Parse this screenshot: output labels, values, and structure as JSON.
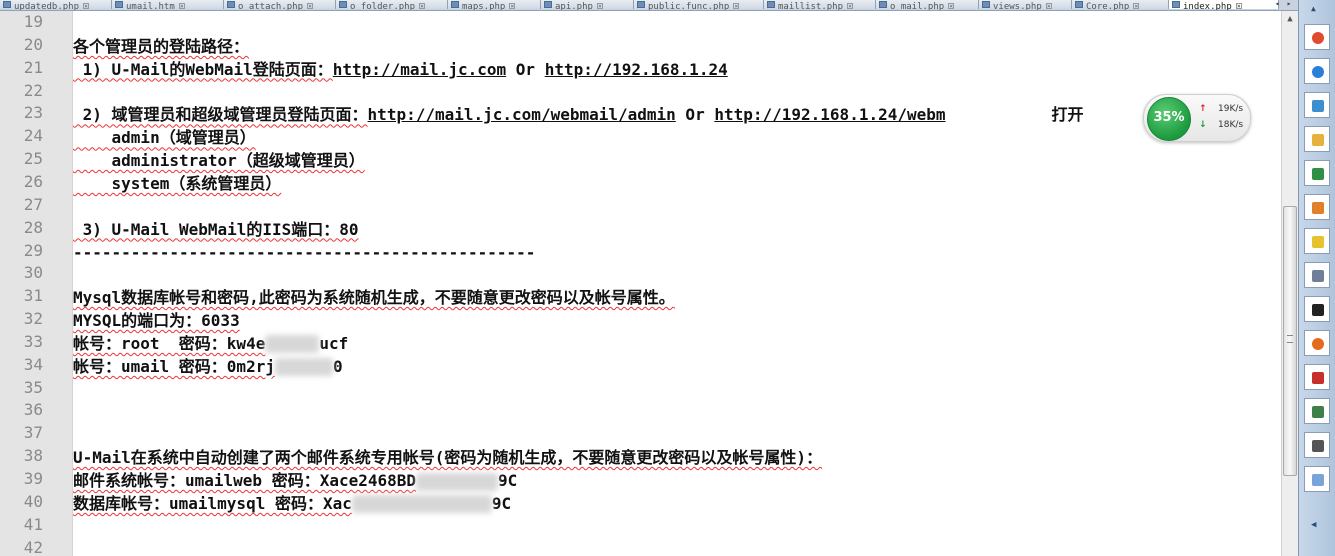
{
  "tabs": [
    {
      "label": "updatedb.php"
    },
    {
      "label": "umail.htm"
    },
    {
      "label": "o_attach.php"
    },
    {
      "label": "o_folder.php"
    },
    {
      "label": "maps.php"
    },
    {
      "label": "api.php"
    },
    {
      "label": "public.func.php"
    },
    {
      "label": "maillist.php"
    },
    {
      "label": "o_mail.php"
    },
    {
      "label": "views.php"
    },
    {
      "label": "Core.php"
    },
    {
      "label": "index.php",
      "active": true
    }
  ],
  "lines": [
    {
      "num": "19",
      "text": ""
    },
    {
      "num": "20",
      "text": "各个管理员的登陆路径："
    },
    {
      "num": "21",
      "pre": " 1) U-Mail的WebMail登陆页面：",
      "url1": "http://mail.jc.com",
      "mid": " Or ",
      "url2": "http://192.168.1.24"
    },
    {
      "num": "22",
      "text": ""
    },
    {
      "num": "23",
      "pre": " 2) 域管理员和超级域管理员登陆页面：",
      "url1": "http://mail.jc.com/webmail/admin",
      "mid": " Or ",
      "url2": "http://192.168.1.24/webm",
      "post": "           打开"
    },
    {
      "num": "24",
      "text": "    admin（域管理员）"
    },
    {
      "num": "25",
      "text": "    administrator（超级域管理员）"
    },
    {
      "num": "26",
      "text": "    system（系统管理员）"
    },
    {
      "num": "27",
      "text": ""
    },
    {
      "num": "28",
      "text": " 3) U-Mail WebMail的IIS端口：80"
    },
    {
      "num": "29",
      "text": "------------------------------------------------"
    },
    {
      "num": "30",
      "text": ""
    },
    {
      "num": "31",
      "text": "Mysql数据库帐号和密码,此密码为系统随机生成，不要随意更改密码以及帐号属性。"
    },
    {
      "num": "32",
      "text": "MYSQL的端口为：6033"
    },
    {
      "num": "33",
      "pre": "帐号：root  密码：kw4e",
      "post": "ucf"
    },
    {
      "num": "34",
      "pre": "帐号：umail 密码：0m2rj",
      "post": "0"
    },
    {
      "num": "35",
      "text": ""
    },
    {
      "num": "36",
      "text": ""
    },
    {
      "num": "37",
      "text": ""
    },
    {
      "num": "38",
      "text": "U-Mail在系统中自动创建了两个邮件系统专用帐号(密码为随机生成，不要随意更改密码以及帐号属性)："
    },
    {
      "num": "39",
      "pre": "邮件系统帐号：umailweb 密码：Xace2468BD",
      "post": "9C"
    },
    {
      "num": "40",
      "pre": "数据库帐号：umailmysql 密码：Xac",
      "post": "9C"
    },
    {
      "num": "41",
      "text": ""
    },
    {
      "num": "42",
      "text": ""
    }
  ],
  "netwidget": {
    "percent": "35%",
    "up_rate": "19K/s",
    "down_rate": "18K/s",
    "up_arrow": "↑",
    "down_arrow": "↓"
  },
  "scrollbar": {
    "up": "▲",
    "down": "▼"
  },
  "launcher": {
    "up_arrow": "▲",
    "down_arrow": "◀",
    "icons": [
      "chrome-icon",
      "ie-icon",
      "app-icon",
      "folder-icon",
      "excel-icon",
      "box-icon",
      "star-icon",
      "doc-icon",
      "cmd-icon",
      "firefox-icon",
      "tool-icon",
      "app2-icon",
      "app3-icon",
      "app4-icon"
    ],
    "colors": {
      "chrome": "#e04a2e",
      "ie": "#2b7fd6",
      "app": "#3a8fd1",
      "folder": "#e6b23c",
      "excel": "#2f8f44",
      "box": "#e0812a",
      "star": "#e6c22e",
      "doc": "#6f7f99",
      "cmd": "#222222",
      "firefox": "#e46a1f",
      "tool": "#c7302a",
      "app2": "#3f7f48",
      "app3": "#555555",
      "app4": "#7aa4d8"
    }
  },
  "colors": {
    "squiggle": "#e33333",
    "gutter_bg": "#e4e4e4",
    "net_green": "#1c9a3e"
  }
}
